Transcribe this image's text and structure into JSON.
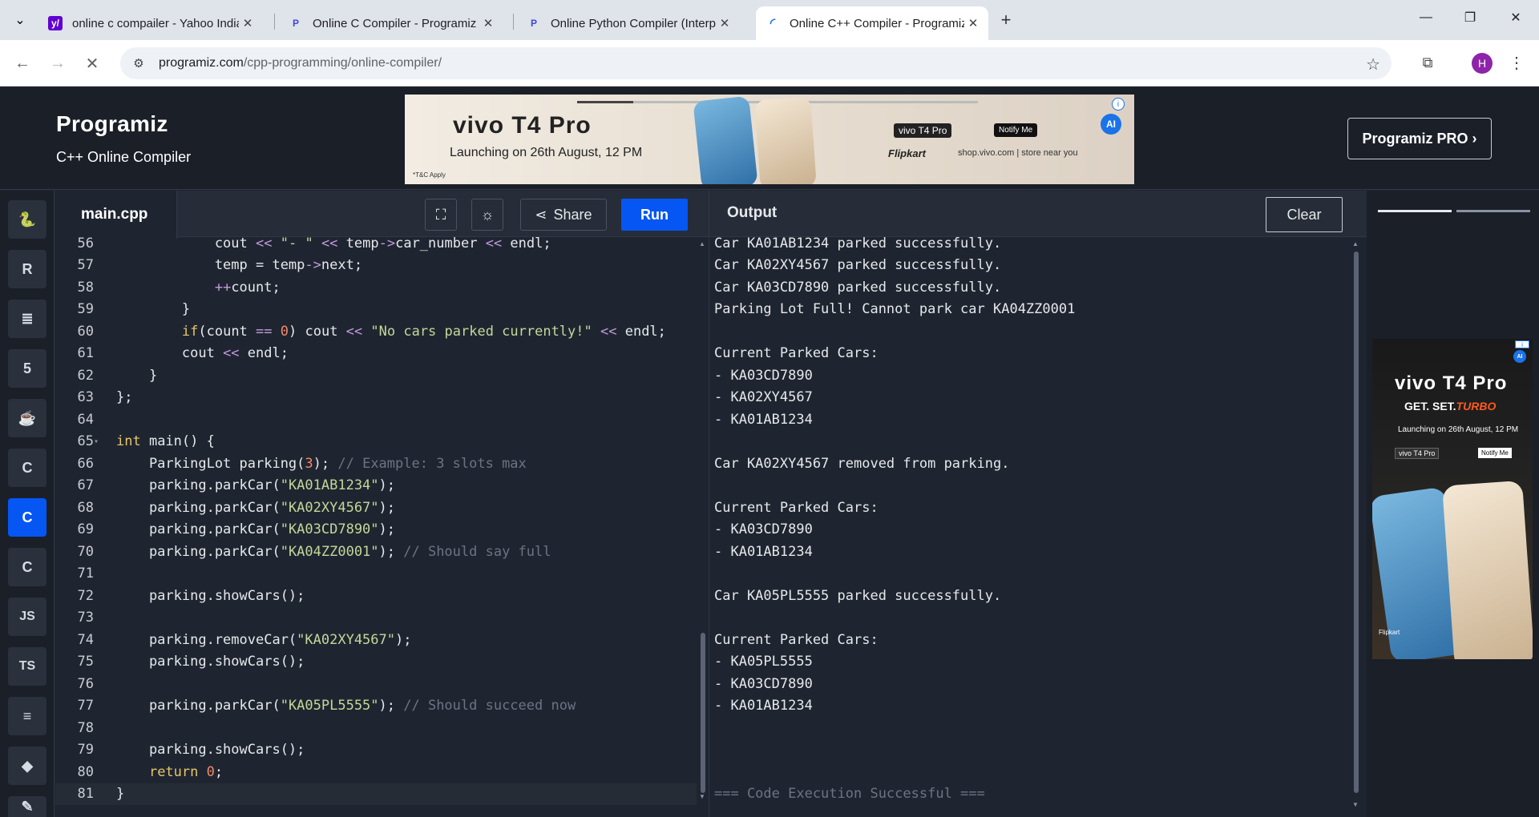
{
  "browser": {
    "tabs": [
      {
        "title": "online c compailer - Yahoo India",
        "favicon": "yahoo-favicon",
        "color": "#6001d2"
      },
      {
        "title": "Online C Compiler - Programiz",
        "favicon": "programiz-favicon",
        "color": "#3c4ad1"
      },
      {
        "title": "Online Python Compiler (Interpreter)",
        "favicon": "programiz-favicon",
        "color": "#3c4ad1"
      },
      {
        "title": "Online C++ Compiler - Programiz",
        "favicon": "loading-favicon",
        "color": "#1a73e8"
      }
    ],
    "active_tab": 3,
    "url_host": "programiz.com",
    "url_path": "/cpp-programming/online-compiler/",
    "profile_initial": "H"
  },
  "header": {
    "brand": "Programiz",
    "subtitle": "C++ Online Compiler",
    "pro_button": "Programiz PRO ›"
  },
  "ad_banner": {
    "headline": "vivo T4 Pro",
    "launch": "Launching on 26th August, 12 PM",
    "terms": "*T&C Apply",
    "product_tag": "vivo T4 Pro",
    "notify": "Notify Me",
    "retailer": "Flipkart",
    "shop": "shop.vivo.com | store near you",
    "info": "i",
    "ai_badge": "AI"
  },
  "sidebar": {
    "languages": [
      {
        "name": "python-icon",
        "glyph": "🐍"
      },
      {
        "name": "r-icon",
        "glyph": "R"
      },
      {
        "name": "sql-icon",
        "glyph": "≣"
      },
      {
        "name": "html5-icon",
        "glyph": "5"
      },
      {
        "name": "java-icon",
        "glyph": "☕"
      },
      {
        "name": "c-icon",
        "glyph": "C"
      },
      {
        "name": "cpp-icon",
        "glyph": "C"
      },
      {
        "name": "csharp-icon",
        "glyph": "C"
      },
      {
        "name": "javascript-icon",
        "glyph": "JS"
      },
      {
        "name": "typescript-icon",
        "glyph": "TS"
      },
      {
        "name": "go-icon",
        "glyph": "≡"
      },
      {
        "name": "swift-icon",
        "glyph": "◆"
      },
      {
        "name": "rust-icon",
        "glyph": "✎"
      }
    ],
    "active_index": 6
  },
  "editor": {
    "filename": "main.cpp",
    "share_label": "Share",
    "run_label": "Run",
    "lines": [
      {
        "n": "56",
        "code": "            cout << \"- \" << temp->car_number << endl;"
      },
      {
        "n": "57",
        "code": "            temp = temp->next;"
      },
      {
        "n": "58",
        "code": "            ++count;"
      },
      {
        "n": "59",
        "code": "        }"
      },
      {
        "n": "60",
        "code": "        if(count == 0) cout << \"No cars parked currently!\" << endl;"
      },
      {
        "n": "61",
        "code": "        cout << endl;"
      },
      {
        "n": "62",
        "code": "    }"
      },
      {
        "n": "63",
        "code": "};"
      },
      {
        "n": "64",
        "code": ""
      },
      {
        "n": "65",
        "code": "int main() {",
        "fold": true
      },
      {
        "n": "66",
        "code": "    ParkingLot parking(3); // Example: 3 slots max"
      },
      {
        "n": "67",
        "code": "    parking.parkCar(\"KA01AB1234\");"
      },
      {
        "n": "68",
        "code": "    parking.parkCar(\"KA02XY4567\");"
      },
      {
        "n": "69",
        "code": "    parking.parkCar(\"KA03CD7890\");"
      },
      {
        "n": "70",
        "code": "    parking.parkCar(\"KA04ZZ0001\"); // Should say full"
      },
      {
        "n": "71",
        "code": ""
      },
      {
        "n": "72",
        "code": "    parking.showCars();"
      },
      {
        "n": "73",
        "code": ""
      },
      {
        "n": "74",
        "code": "    parking.removeCar(\"KA02XY4567\");"
      },
      {
        "n": "75",
        "code": "    parking.showCars();"
      },
      {
        "n": "76",
        "code": ""
      },
      {
        "n": "77",
        "code": "    parking.parkCar(\"KA05PL5555\"); // Should succeed now"
      },
      {
        "n": "78",
        "code": ""
      },
      {
        "n": "79",
        "code": "    parking.showCars();"
      },
      {
        "n": "80",
        "code": "    return 0;"
      },
      {
        "n": "81",
        "code": "}",
        "current": true
      }
    ]
  },
  "output": {
    "title": "Output",
    "clear_label": "Clear",
    "lines": [
      "Car KA01AB1234 parked successfully.",
      "Car KA02XY4567 parked successfully.",
      "Car KA03CD7890 parked successfully.",
      "Parking Lot Full! Cannot park car KA04ZZ0001",
      "",
      "Current Parked Cars:",
      "- KA03CD7890",
      "- KA02XY4567",
      "- KA01AB1234",
      "",
      "Car KA02XY4567 removed from parking.",
      "",
      "Current Parked Cars:",
      "- KA03CD7890",
      "- KA01AB1234",
      "",
      "Car KA05PL5555 parked successfully.",
      "",
      "Current Parked Cars:",
      "- KA05PL5555",
      "- KA03CD7890",
      "- KA01AB1234",
      "",
      "",
      "",
      "=== Code Execution Successful ==="
    ]
  },
  "side_ad": {
    "headline": "vivo T4 Pro",
    "tagline_prefix": "GET. SET.",
    "tagline_accent": "TURBO",
    "launch": "Launching on 26th August, 12 PM",
    "product_tag": "vivo T4 Pro",
    "notify": "Notify Me",
    "retailer": "Flipkart",
    "info": "i",
    "ai_badge": "AI"
  },
  "colors": {
    "accent": "#0556f3",
    "background": "#1f2530",
    "panel": "#262d38"
  }
}
